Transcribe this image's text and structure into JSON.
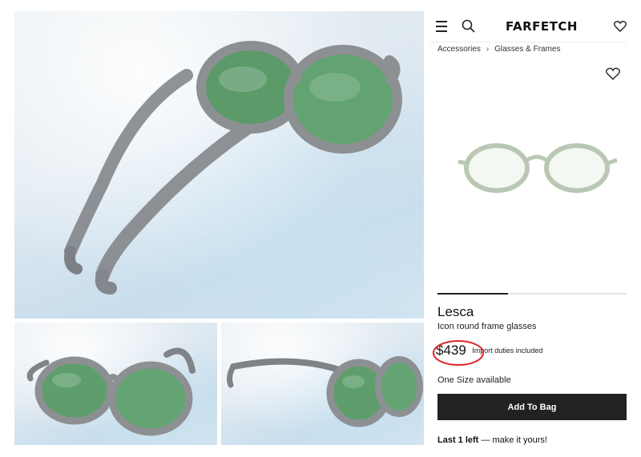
{
  "header": {
    "brand": "FARFETCH"
  },
  "breadcrumb": {
    "items": [
      "Accessories",
      "Glasses & Frames"
    ],
    "separator": "›"
  },
  "product": {
    "brand": "Lesca",
    "description": "Icon round frame glasses",
    "price": "$439",
    "duties_note": "Import duties included",
    "size": "One Size available",
    "add_to_bag_label": "Add To Bag",
    "stock_bold": "Last 1 left",
    "stock_rest": " — make it yours!"
  },
  "colors": {
    "button_bg": "#222222",
    "annotation_circle": "#e0242a",
    "lens_green": "#5f9e6c",
    "frame_gray": "#8d9093"
  },
  "icons": [
    "menu-icon",
    "search-icon",
    "heart-icon",
    "chevron-right-icon"
  ]
}
